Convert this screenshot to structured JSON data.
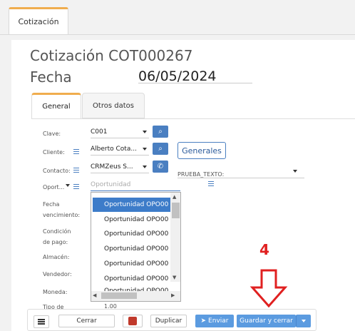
{
  "top_tab": {
    "label": "Cotización"
  },
  "header": {
    "title": "Cotización COT000267",
    "fecha_label": "Fecha",
    "fecha_value": "06/05/2024"
  },
  "form_tabs": [
    {
      "label": "General"
    },
    {
      "label": "Otros datos"
    }
  ],
  "fields": {
    "clave": {
      "label": "Clave:",
      "value": "C001"
    },
    "cliente": {
      "label": "Cliente:",
      "value": "Alberto Cota..."
    },
    "contacto": {
      "label": "Contacto:",
      "value": "CRMZeus S..."
    },
    "oportunidad": {
      "label": "Oport...",
      "placeholder": "Oportunidad"
    },
    "fecha_vencimiento": {
      "label_line1": "Fecha",
      "label_line2": "vencimiento:"
    },
    "condicion_pago": {
      "label_line1": "Condición",
      "label_line2": "de pago:"
    },
    "almacen": {
      "label": "Almacén:"
    },
    "vendedor": {
      "label": "Vendedor:"
    },
    "moneda": {
      "label": "Moneda:"
    },
    "tipo_cambio": {
      "label": "Tipo de",
      "value": "1.00"
    }
  },
  "generales_button": "Generales",
  "prueba_texto": {
    "label": "PRUEBA_TEXTO:"
  },
  "dropdown": {
    "items": [
      "Oportunidad OPO00",
      "Oportunidad OPO00",
      "Oportunidad OPO00",
      "Oportunidad OPO00",
      "Oportunidad OPO00",
      "Oportunidad OPO00",
      "Oportunidad OPO00"
    ],
    "selected_index": 0
  },
  "annotation_marker": "4",
  "bottom_bar": {
    "cerrar": "Cerrar",
    "duplicar": "Duplicar",
    "enviar": "Enviar",
    "guardar_cerrar": "Guardar y cerrar"
  },
  "colors": {
    "accent": "#4a7fc1",
    "tab_highlight": "#f0ad4e",
    "marker": "#e02020",
    "primary_button": "#5b9be0"
  }
}
